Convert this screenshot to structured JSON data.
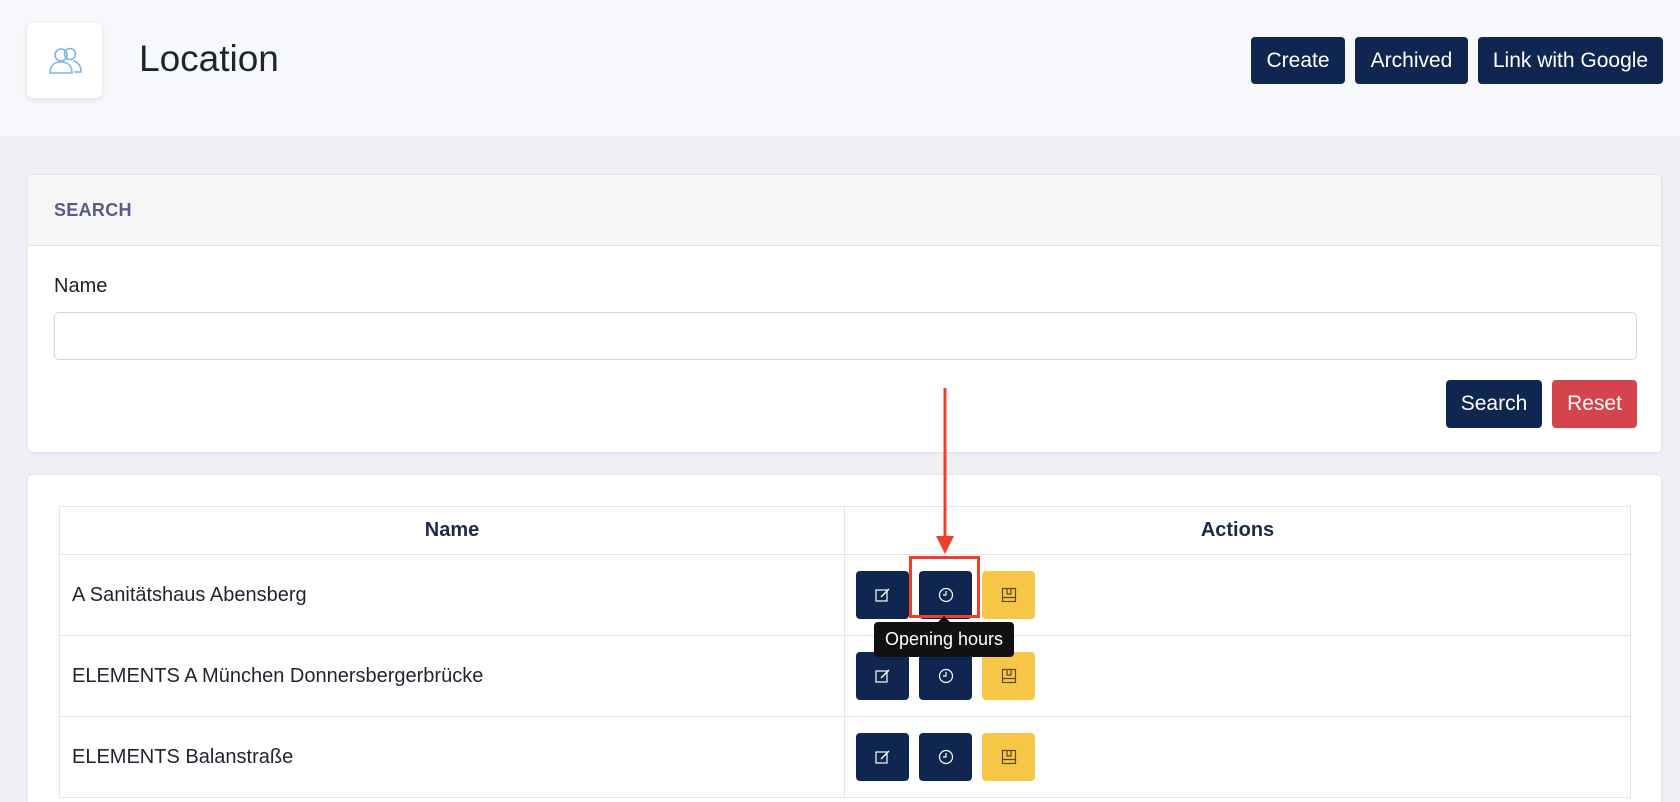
{
  "header": {
    "title": "Location",
    "buttons": {
      "create": "Create",
      "archived": "Archived",
      "link_google": "Link with Google"
    }
  },
  "search": {
    "heading": "SEARCH",
    "name_label": "Name",
    "name_value": "",
    "name_placeholder": "",
    "search_label": "Search",
    "reset_label": "Reset"
  },
  "table": {
    "columns": [
      "Name",
      "Actions"
    ],
    "rows": [
      {
        "name": "A Sanitätshaus Abensberg"
      },
      {
        "name": "ELEMENTS A München Donnersbergerbrücke"
      },
      {
        "name": "ELEMENTS Balanstraße"
      }
    ]
  },
  "tooltip": {
    "text": "Opening hours"
  },
  "colors": {
    "primary": "#0f2650",
    "danger": "#d5434d",
    "warning": "#f7c646",
    "annotation": "#e8412c"
  },
  "icons": {
    "logo": "users-icon",
    "edit": "edit-icon",
    "hours": "clock-icon",
    "archive": "archive-icon"
  }
}
